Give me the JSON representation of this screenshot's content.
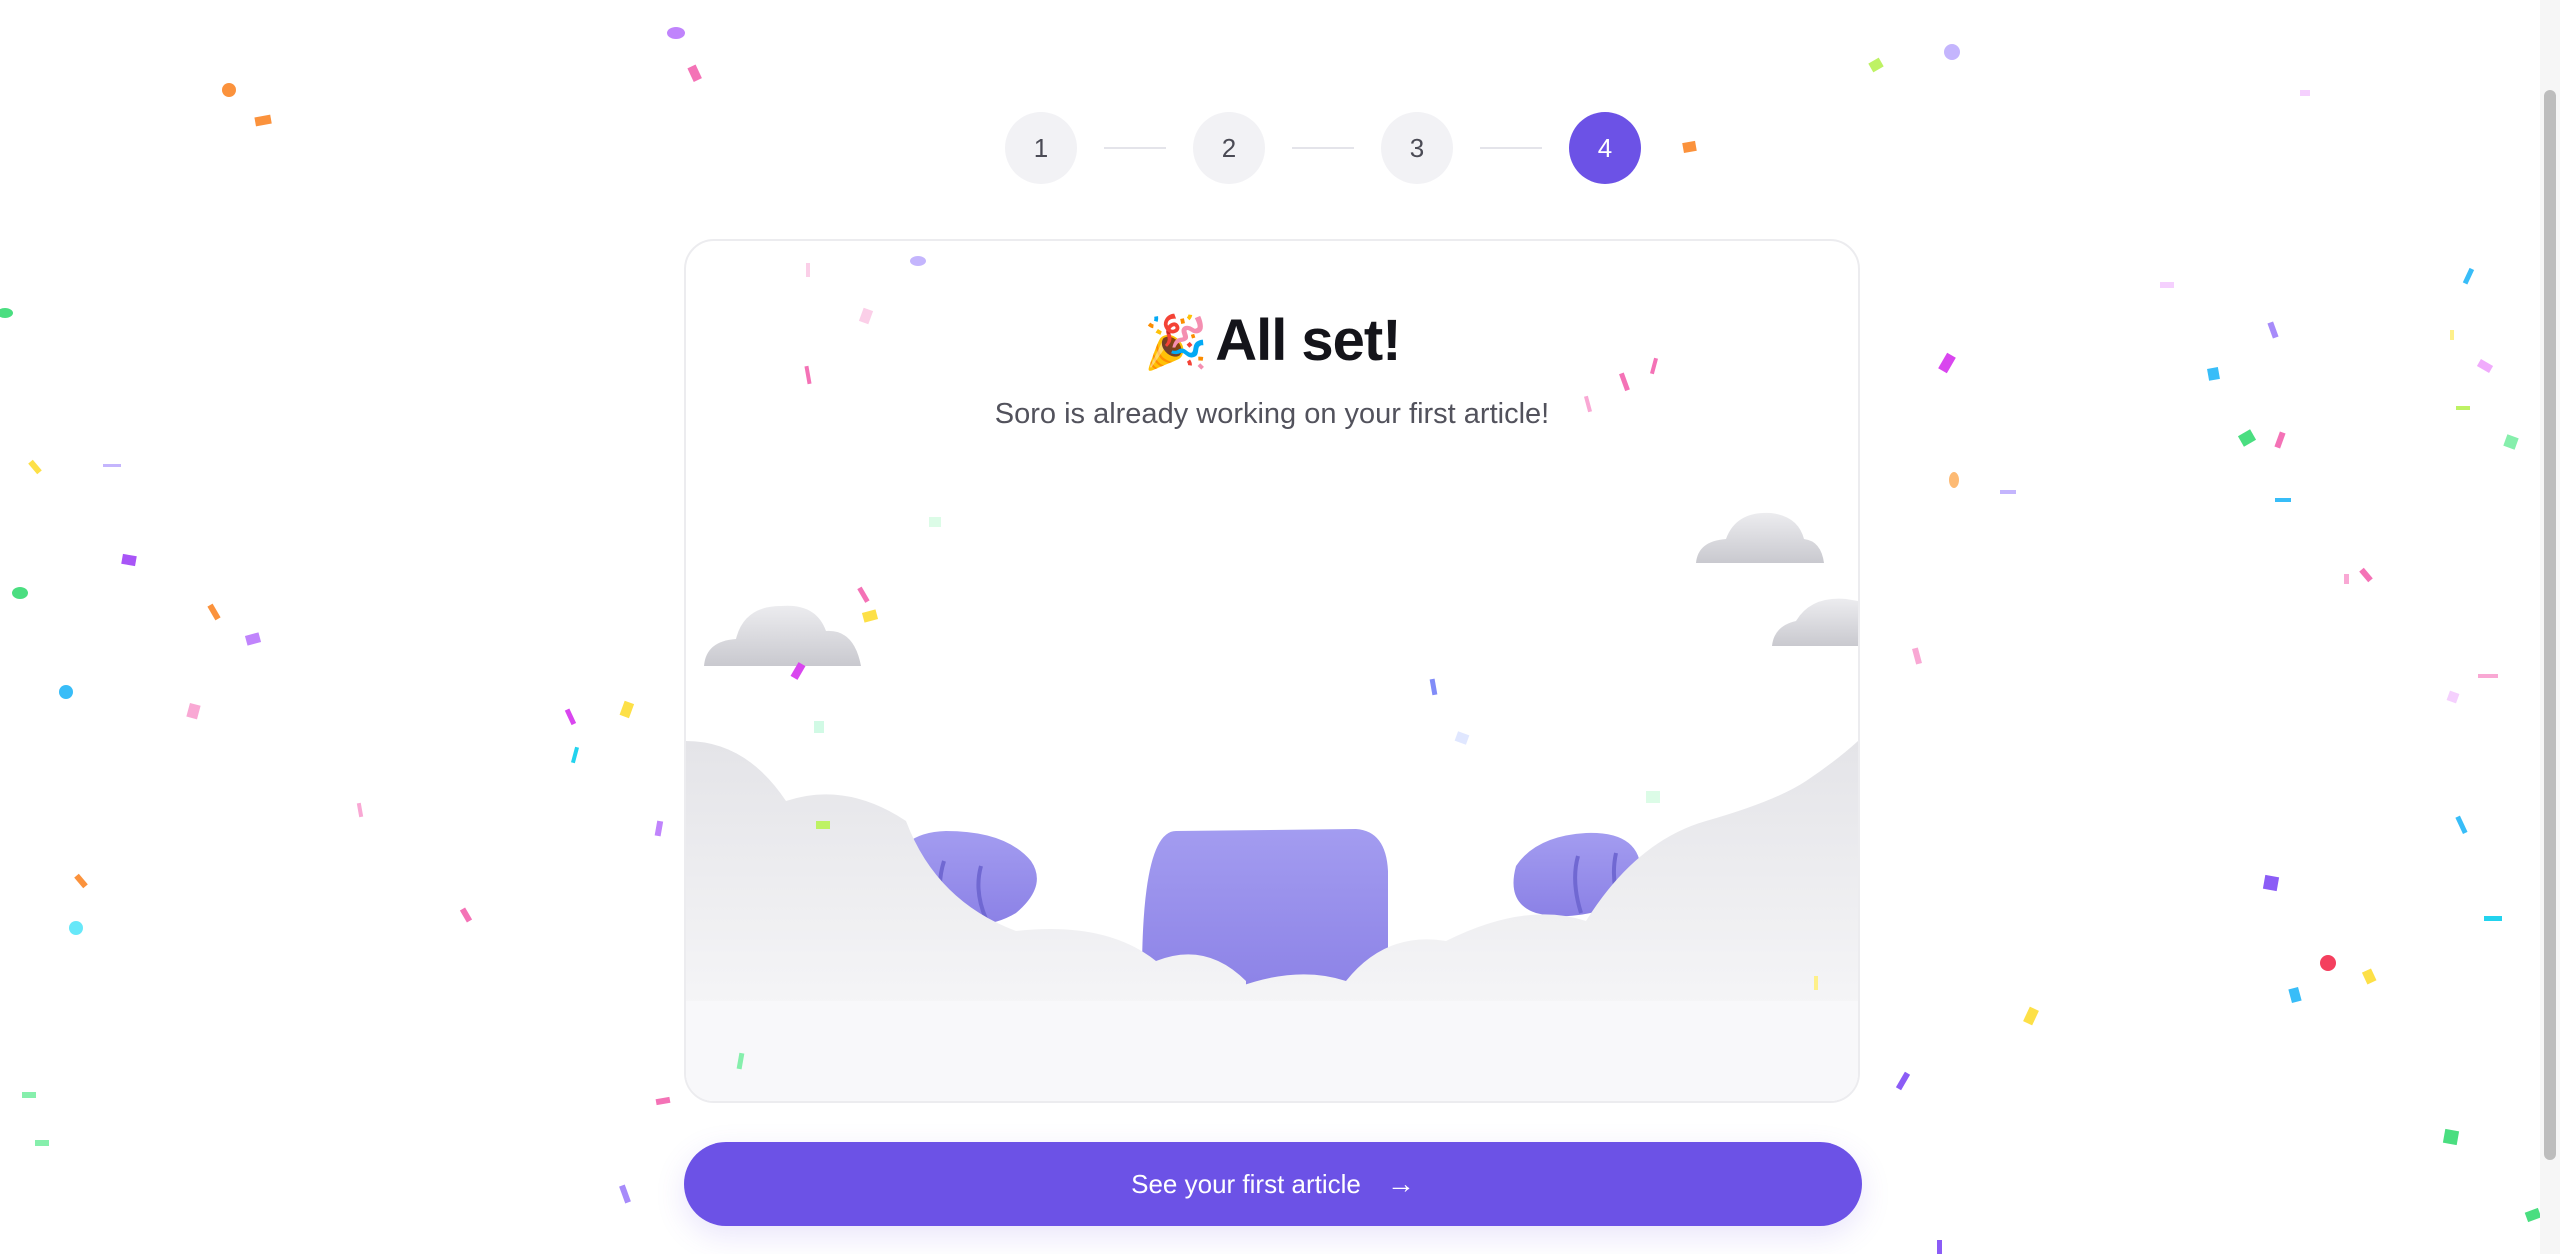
{
  "stepper": {
    "steps": [
      {
        "label": "1",
        "active": false
      },
      {
        "label": "2",
        "active": false
      },
      {
        "label": "3",
        "active": false
      },
      {
        "label": "4",
        "active": true
      }
    ],
    "accent_color": "#6c52e6"
  },
  "card": {
    "emoji": "🎉",
    "title": "All set!",
    "subtitle": "Soro is already working on your first article!"
  },
  "cta": {
    "label": "See your first article",
    "icon": "arrow-right-icon"
  },
  "colors": {
    "accent": "#6c52e6",
    "text_dark": "#14141a",
    "text_muted": "#52525c"
  }
}
